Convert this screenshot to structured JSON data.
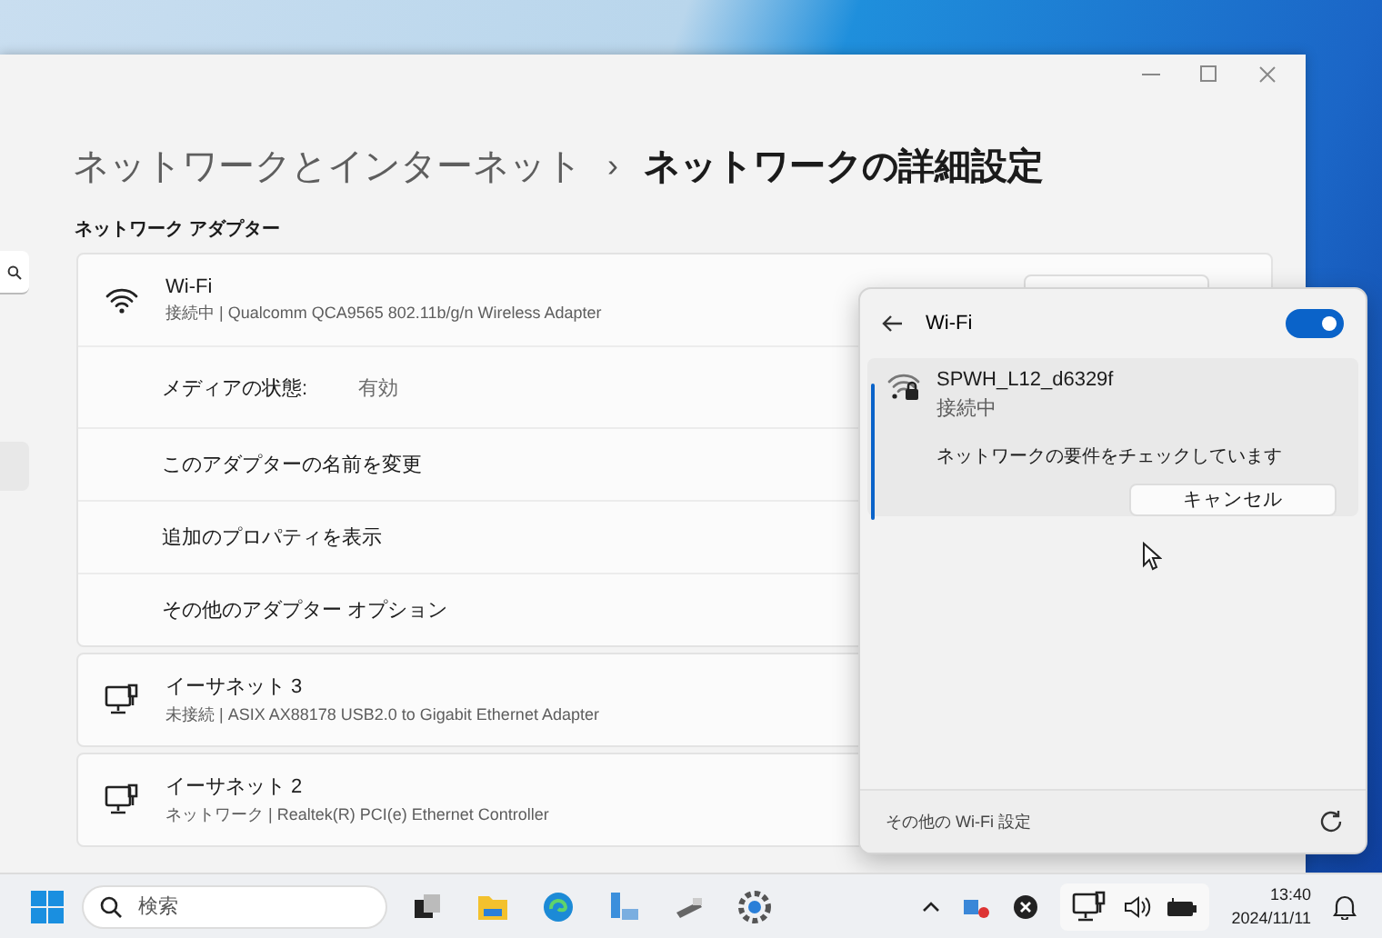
{
  "settings_window": {
    "breadcrumb": {
      "parent": "ネットワークとインターネット",
      "separator": "›",
      "current": "ネットワークの詳細設定"
    },
    "section_label": "ネットワーク アダプター",
    "adapters": [
      {
        "kind": "wifi",
        "name": "Wi-Fi",
        "status": "接続中 | Qualcomm QCA9565 802.11b/g/n Wireless Adapter",
        "details": [
          {
            "kind": "field",
            "label": "メディアの状態:",
            "value": "有効"
          },
          {
            "kind": "action",
            "label": "このアダプターの名前を変更"
          },
          {
            "kind": "action",
            "label": "追加のプロパティを表示"
          },
          {
            "kind": "action",
            "label": "その他のアダプター オプション"
          }
        ]
      },
      {
        "kind": "ethernet",
        "name": "イーサネット 3",
        "status": "未接続 | ASIX AX88178 USB2.0 to Gigabit Ethernet Adapter"
      },
      {
        "kind": "ethernet",
        "name": "イーサネット 2",
        "status": "ネットワーク | Realtek(R) PCI(e) Ethernet Controller"
      }
    ]
  },
  "wifi_flyout": {
    "title": "Wi-Fi",
    "on": true,
    "network": {
      "ssid": "SPWH_L12_d6329f",
      "status": "接続中",
      "message": "ネットワークの要件をチェックしています",
      "button": "キャンセル"
    },
    "footer_link": "その他の Wi-Fi 設定"
  },
  "taskbar": {
    "search": {
      "placeholder": "検索"
    },
    "time": "13:40",
    "date": "2024/11/11"
  }
}
